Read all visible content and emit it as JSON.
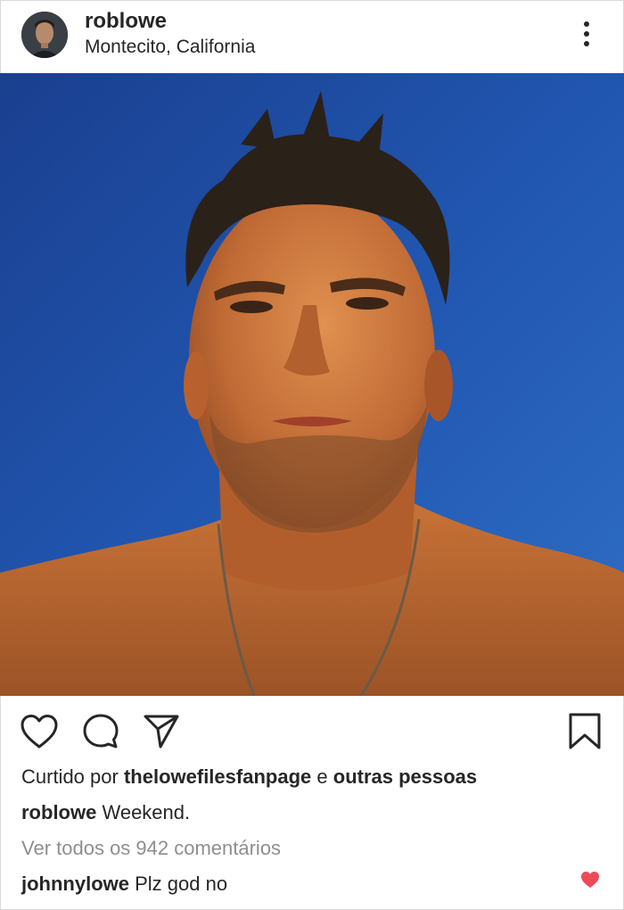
{
  "post": {
    "username": "roblowe",
    "location": "Montecito, California",
    "colors": {
      "sky": "#1e4fa6",
      "skin": "#c9733a",
      "like_red": "#ed4956",
      "muted_text": "#8e8e8e"
    },
    "icons": {
      "more": "more-vertical-icon",
      "like": "heart-icon",
      "comment": "comment-icon",
      "share": "paper-plane-icon",
      "save": "bookmark-icon"
    }
  },
  "likes": {
    "prefix": "Curtido por",
    "user": "thelowefilesfanpage",
    "joiner": "e",
    "others": "outras pessoas"
  },
  "caption": {
    "user": "roblowe",
    "text": "Weekend."
  },
  "view_all_comments": "Ver todos os 942 comentários",
  "comment": {
    "user": "johnnylowe",
    "text": "Plz god no"
  }
}
